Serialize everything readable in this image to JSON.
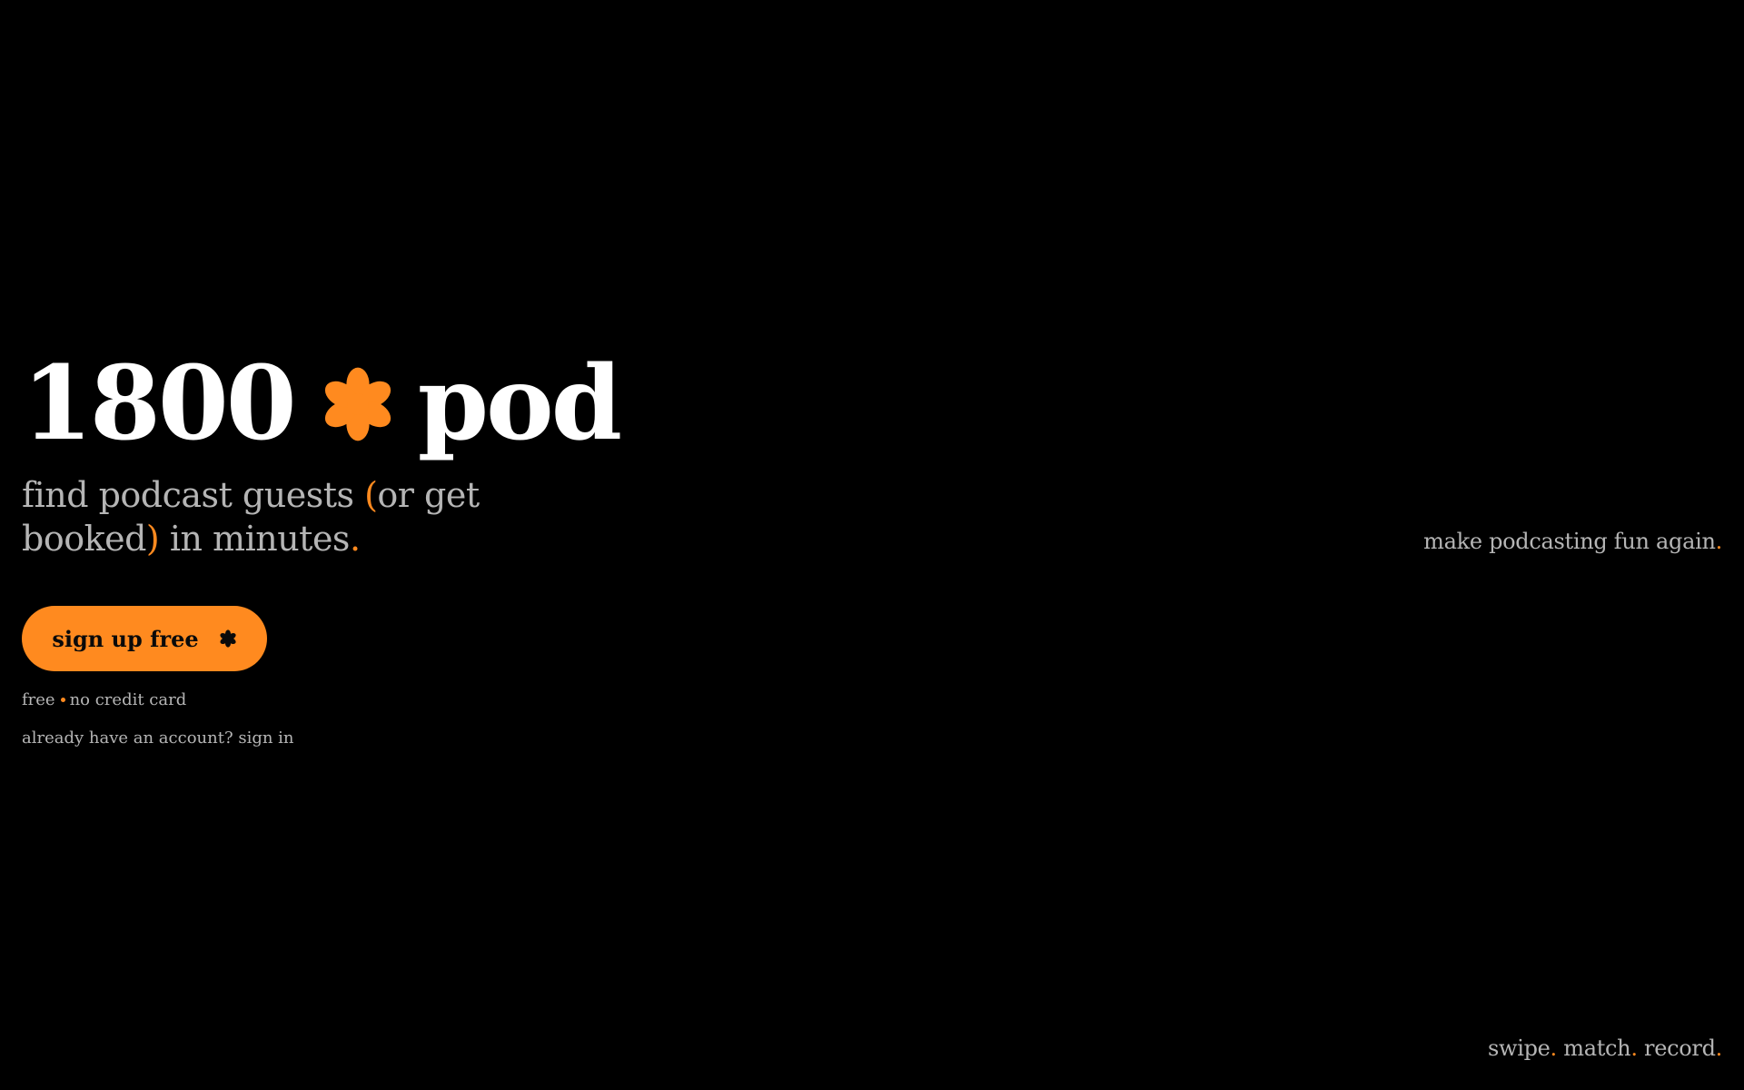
{
  "brand": {
    "name_left": "1800",
    "name_right": "pod",
    "flower_icon": "flower-icon",
    "accent_color": "#ff8a1f"
  },
  "tagline": {
    "part1": "find podcast guests ",
    "paren_open": "(",
    "paren_text": "or get booked",
    "paren_close": ")",
    "part2": " in minutes",
    "period": "."
  },
  "cta": {
    "label": "sign up free",
    "icon": "flower-icon"
  },
  "fineprint": {
    "left": "free",
    "right": "no credit card"
  },
  "signin": {
    "prompt": "already have an account? ",
    "link": "sign in"
  },
  "side_tagline": {
    "text": "make podcasting fun again",
    "period": "."
  },
  "bottom_tagline": {
    "word1": "swipe",
    "word2": "match",
    "word3": "record",
    "sep": "."
  }
}
